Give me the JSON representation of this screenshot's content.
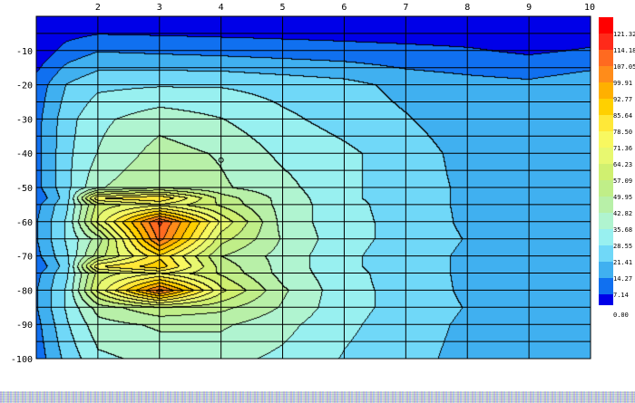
{
  "chart_data": {
    "type": "heatmap",
    "x_ticks": [
      "2",
      "3",
      "4",
      "5",
      "6",
      "7",
      "8",
      "9",
      "10"
    ],
    "y_ticks": [
      "-10",
      "-20",
      "-30",
      "-40",
      "-50",
      "-60",
      "-70",
      "-80",
      "-90",
      "-100"
    ],
    "xlim": [
      1,
      10
    ],
    "ylim": [
      -100,
      0
    ],
    "grid": true,
    "colorbar": {
      "placement": "right",
      "levels": [
        "121.32",
        "114.18",
        "107.05",
        "99.91",
        "92.77",
        "85.64",
        "78.50",
        "71.36",
        "64.23",
        "57.09",
        "49.95",
        "42.82",
        "35.68",
        "28.55",
        "21.41",
        "14.27",
        "7.14",
        "0.00"
      ],
      "colors": [
        "#ff0000",
        "#ff2a1a",
        "#ff6a20",
        "#ff8c1a",
        "#ffb000",
        "#ffd000",
        "#ffe838",
        "#f8f860",
        "#e8f870",
        "#d0f070",
        "#c0ee88",
        "#b8f0a8",
        "#b0f4d0",
        "#98f0f0",
        "#70d8f8",
        "#40b0f0",
        "#1070f0",
        "#0000e8"
      ]
    },
    "x": [
      1,
      1.5,
      2,
      3,
      4,
      5,
      6,
      7,
      8,
      9,
      10
    ],
    "y": [
      0,
      -10,
      -20,
      -30,
      -40,
      -50,
      -53,
      -55,
      -60,
      -65,
      -70,
      -73,
      -75,
      -80,
      -85,
      -90,
      -100
    ],
    "z": [
      [
        0,
        0,
        0,
        0,
        0,
        0,
        0,
        0,
        0,
        0,
        0
      ],
      [
        2,
        10,
        14,
        13,
        12,
        11,
        10,
        9,
        8,
        6,
        8
      ],
      [
        10,
        22,
        27,
        28,
        28,
        26,
        24,
        19,
        17,
        16,
        19
      ],
      [
        12,
        26,
        34,
        40,
        36,
        30,
        26,
        22,
        17,
        16,
        18
      ],
      [
        12,
        27,
        36,
        46,
        42,
        34,
        30,
        25,
        19,
        17,
        18
      ],
      [
        12,
        27,
        42,
        50,
        44,
        38,
        30,
        25,
        20,
        17,
        17
      ],
      [
        8,
        26,
        78,
        86,
        54,
        40,
        30,
        25,
        20,
        17,
        17
      ],
      [
        12,
        28,
        60,
        70,
        56,
        40,
        31,
        25,
        20,
        17,
        17
      ],
      [
        14,
        30,
        66,
        116,
        70,
        40,
        31,
        26,
        20,
        18,
        17
      ],
      [
        14,
        30,
        46,
        110,
        60,
        42,
        31,
        26,
        21,
        18,
        17
      ],
      [
        12,
        28,
        54,
        84,
        50,
        40,
        30,
        25,
        20,
        17,
        17
      ],
      [
        8,
        26,
        78,
        90,
        54,
        40,
        30,
        25,
        20,
        16,
        17
      ],
      [
        12,
        28,
        60,
        72,
        56,
        40,
        31,
        25,
        20,
        17,
        17
      ],
      [
        14,
        30,
        66,
        110,
        66,
        44,
        31,
        26,
        20,
        17,
        17
      ],
      [
        14,
        30,
        46,
        56,
        52,
        42,
        31,
        26,
        21,
        18,
        17
      ],
      [
        12,
        28,
        40,
        44,
        44,
        38,
        30,
        25,
        20,
        18,
        17
      ],
      [
        10,
        24,
        34,
        38,
        38,
        34,
        28,
        24,
        19,
        17,
        16
      ]
    ]
  }
}
